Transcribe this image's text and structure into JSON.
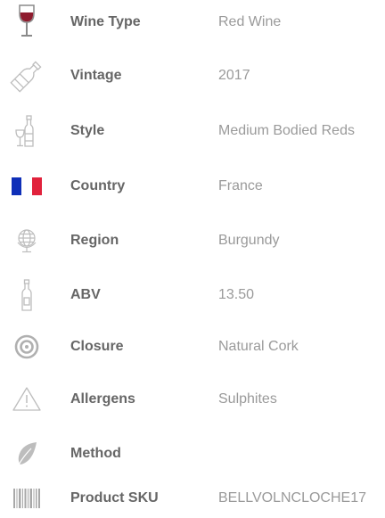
{
  "attributes": [
    {
      "icon": "wine-glass-icon",
      "label": "Wine Type",
      "value": "Red Wine"
    },
    {
      "icon": "wine-bottle-icon",
      "label": "Vintage",
      "value": "2017"
    },
    {
      "icon": "bottle-and-glass-icon",
      "label": "Style",
      "value": "Medium Bodied Reds"
    },
    {
      "icon": "france-flag-icon",
      "label": "Country",
      "value": "France"
    },
    {
      "icon": "globe-icon",
      "label": "Region",
      "value": "Burgundy"
    },
    {
      "icon": "bottle-icon",
      "label": "ABV",
      "value": "13.50"
    },
    {
      "icon": "closure-target-icon",
      "label": "Closure",
      "value": "Natural Cork"
    },
    {
      "icon": "warning-triangle-icon",
      "label": "Allergens",
      "value": "Sulphites"
    },
    {
      "icon": "leaf-icon",
      "label": "Method",
      "value": ""
    },
    {
      "icon": "barcode-icon",
      "label": "Product SKU",
      "value": "BELLVOLNCLOCHE17"
    }
  ],
  "colors": {
    "label": "#666666",
    "value": "#9a9a9a",
    "icon": "#bdbdbd",
    "wine": "#8e1b2e",
    "flag_blue": "#0f2fb8",
    "flag_red": "#e1223c"
  }
}
